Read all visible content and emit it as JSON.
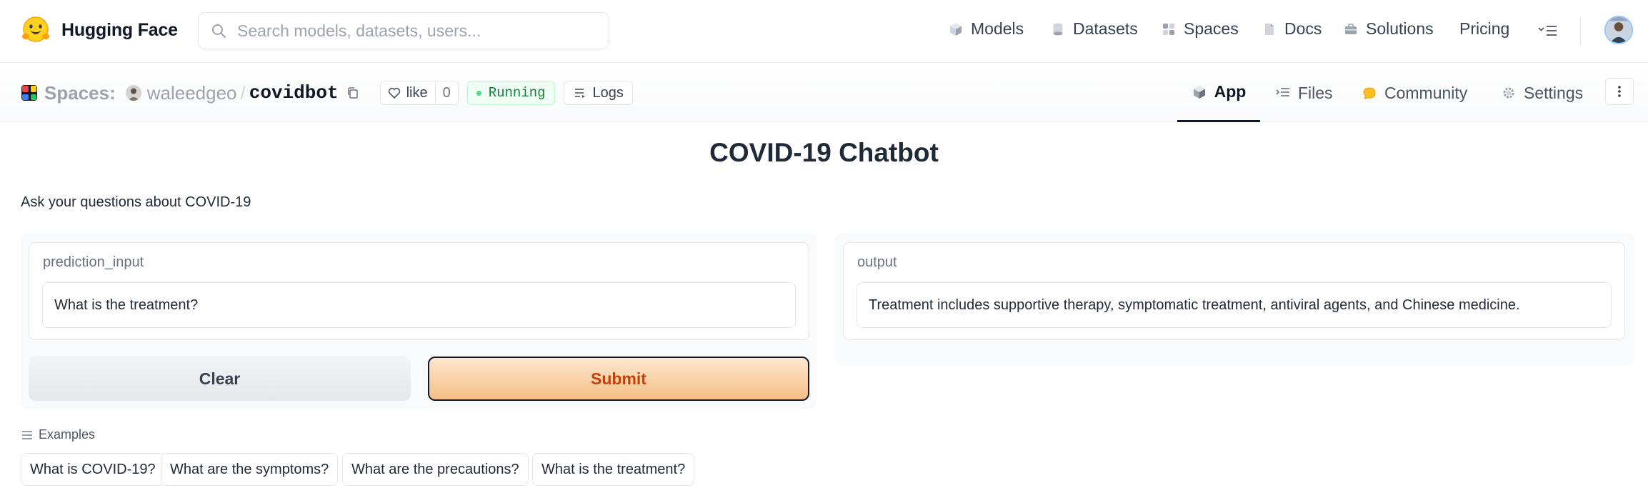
{
  "topnav": {
    "brand": "Hugging Face",
    "search_placeholder": "Search models, datasets, users...",
    "items": [
      {
        "label": "Models",
        "icon": "cube-icon"
      },
      {
        "label": "Datasets",
        "icon": "database-icon"
      },
      {
        "label": "Spaces",
        "icon": "grid-icon"
      },
      {
        "label": "Docs",
        "icon": "doc-icon"
      },
      {
        "label": "Solutions",
        "icon": "briefcase-icon"
      },
      {
        "label": "Pricing",
        "icon": ""
      }
    ]
  },
  "space": {
    "spaces_label": "Spaces:",
    "owner": "waleedgeo",
    "separator": "/",
    "repo": "covidbot",
    "like_label": "like",
    "like_count": "0",
    "status": "Running",
    "logs_label": "Logs",
    "tabs": [
      {
        "label": "App",
        "icon": "app-cube-icon",
        "active": true
      },
      {
        "label": "Files",
        "icon": "files-icon",
        "active": false
      },
      {
        "label": "Community",
        "icon": "community-icon",
        "active": false
      },
      {
        "label": "Settings",
        "icon": "gear-icon",
        "active": false
      }
    ]
  },
  "app": {
    "title": "COVID-19 Chatbot",
    "description": "Ask your questions about COVID-19",
    "input_label": "prediction_input",
    "input_value": "What is the treatment?",
    "output_label": "output",
    "output_value": "Treatment includes supportive therapy, symptomatic treatment, antiviral agents, and Chinese medicine.",
    "clear_label": "Clear",
    "submit_label": "Submit",
    "examples_label": "Examples",
    "examples": [
      "What is COVID-19?",
      "What are the symptoms?",
      "What are the precautions?",
      "What is the treatment?"
    ]
  },
  "colors": {
    "accent_orange": "#c2410c",
    "submit_gradient_top": "#fde8cf",
    "submit_gradient_bottom": "#f5be85",
    "running_green": "#15803d"
  }
}
